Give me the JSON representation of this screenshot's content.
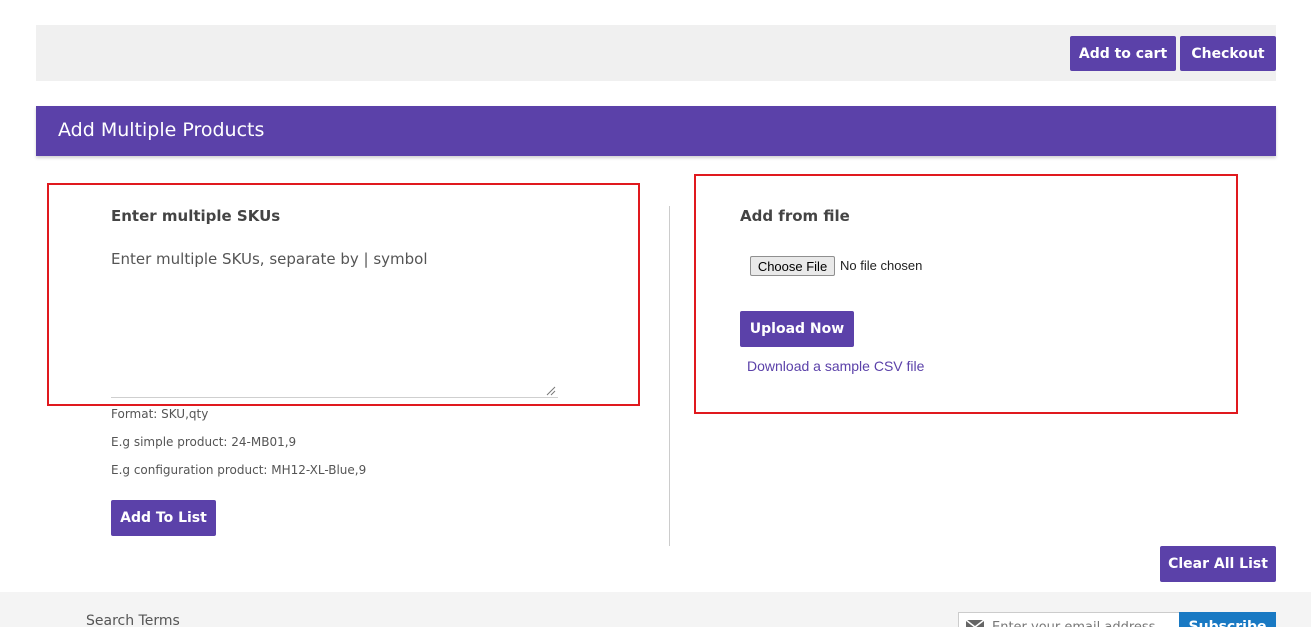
{
  "toolbar": {
    "add_to_cart_label": "Add to cart",
    "checkout_label": "Checkout"
  },
  "banner": {
    "title": "Add Multiple Products"
  },
  "sku_panel": {
    "heading": "Enter multiple SKUs",
    "textarea_value": "",
    "textarea_placeholder": "Enter multiple SKUs, separate by | symbol",
    "format_lines": [
      "Format: SKU,qty",
      "E.g simple product: 24-MB01,9",
      "E.g configuration product: MH12-XL-Blue,9"
    ],
    "add_to_list_label": "Add To List"
  },
  "file_panel": {
    "heading": "Add from file",
    "choose_file_label": "Choose File",
    "file_status": "No file chosen",
    "upload_label": "Upload Now",
    "sample_link_label": "Download a sample CSV file"
  },
  "list_actions": {
    "clear_all_label": "Clear All List"
  },
  "footer": {
    "search_terms_label": "Search Terms",
    "email_value": "",
    "email_placeholder": "Enter your email address",
    "subscribe_label": "Subscribe"
  },
  "colors": {
    "accent": "#5b41a9",
    "highlight": "#e0191e",
    "subscribe": "#1979c3"
  },
  "icons": {
    "mail": "mail-icon",
    "resize": "resize-grip-icon"
  }
}
